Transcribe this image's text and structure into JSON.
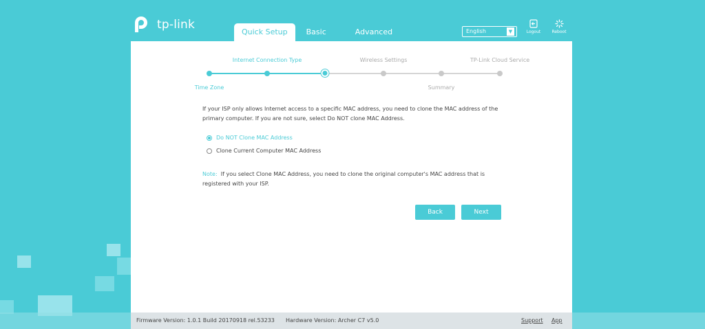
{
  "brand": {
    "logo_text": "tp-link"
  },
  "nav": {
    "tabs": [
      {
        "label": "Quick Setup",
        "active": true
      },
      {
        "label": "Basic",
        "active": false
      },
      {
        "label": "Advanced",
        "active": false
      }
    ]
  },
  "header": {
    "language": "English",
    "logout_label": "Logout",
    "reboot_label": "Reboot"
  },
  "wizard": {
    "steps": [
      {
        "label": "Time Zone",
        "state": "done"
      },
      {
        "label": "Internet Connection Type",
        "state": "done"
      },
      {
        "label": "",
        "state": "current"
      },
      {
        "label": "Wireless Settings",
        "state": "todo"
      },
      {
        "label": "Summary",
        "state": "todo"
      },
      {
        "label": "TP-Link Cloud Service",
        "state": "todo"
      }
    ]
  },
  "main": {
    "intro_line1": "If your ISP only allows Internet access to a specific MAC address, you need to clone the MAC address of the",
    "intro_line2": "primary computer. If you are not sure, select Do NOT clone MAC Address.",
    "options": [
      {
        "label": "Do NOT Clone MAC Address",
        "selected": true
      },
      {
        "label": "Clone Current Computer MAC Address",
        "selected": false
      }
    ],
    "note_label": "Note:",
    "note_line1": "If you select Clone MAC Address, you need to clone the original computer's MAC address that is",
    "note_line2": "registered with your ISP.",
    "back_label": "Back",
    "next_label": "Next"
  },
  "footer": {
    "firmware": "Firmware Version: 1.0.1 Build 20170918 rel.53233",
    "hardware": "Hardware Version: Archer C7 v5.0",
    "support": "Support",
    "app": "App"
  },
  "colors": {
    "accent": "#4acbd6",
    "background": "#4acbd6",
    "footer": "#dde3e6"
  }
}
